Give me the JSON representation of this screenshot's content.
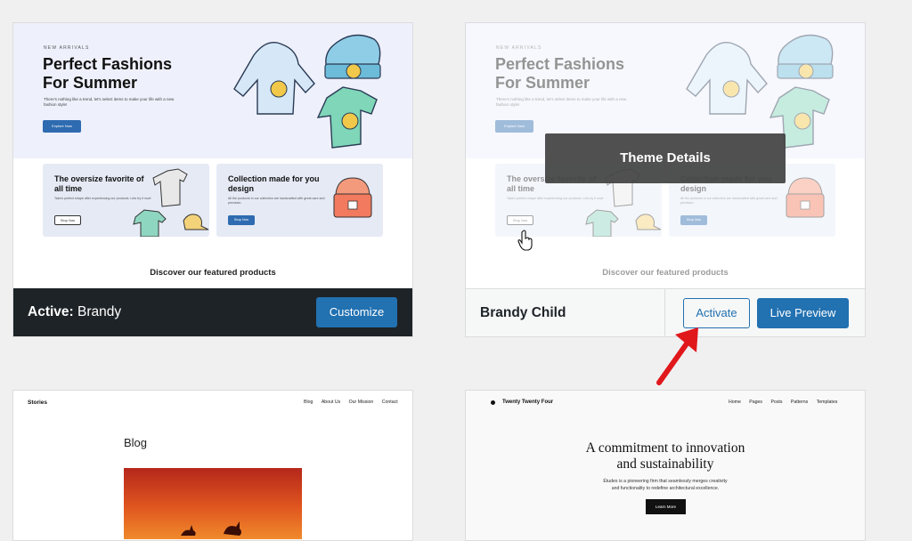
{
  "cards": [
    {
      "eyebrow": "NEW ARRIVALS",
      "heading": "Perfect Fashions For Summer",
      "subtitle": "There's nothing like a trend, let's select items to make your life with a new fashion style!",
      "hero_button": "Explore Now",
      "promo1": {
        "title": "The oversize favorite of all time",
        "desc": "Take's perfect shape after experiencing our products. Lets try it now!",
        "button": "Shop Now"
      },
      "promo2": {
        "title": "Collection made for you design",
        "desc": "All the products in our collection are handcrafted with great care and precision.",
        "button": "Shop Now"
      },
      "discover": "Discover our featured products"
    }
  ],
  "active_theme": {
    "prefix": "Active:",
    "name": "Brandy",
    "customize": "Customize"
  },
  "child_theme": {
    "name": "Brandy Child",
    "activate": "Activate",
    "live_preview": "Live Preview",
    "details": "Theme Details"
  },
  "stories": {
    "site": "Stories",
    "nav": [
      "Blog",
      "About Us",
      "Our Mission",
      "Contact"
    ],
    "heading": "Blog"
  },
  "tt4": {
    "site": "Twenty Twenty Four",
    "nav": [
      "Home",
      "Pages",
      "Posts",
      "Patterns",
      "Templates"
    ],
    "heading1": "A commitment to innovation",
    "heading2": "and sustainability",
    "body1": "Études is a pioneering firm that seamlessly merges creativity",
    "body2": "and functionality to redefine architectural excellence.",
    "button": "Learn More"
  },
  "colors": {
    "accent": "#2271b1",
    "dark_footer": "#1d2327",
    "arrow": "#e0181c"
  }
}
